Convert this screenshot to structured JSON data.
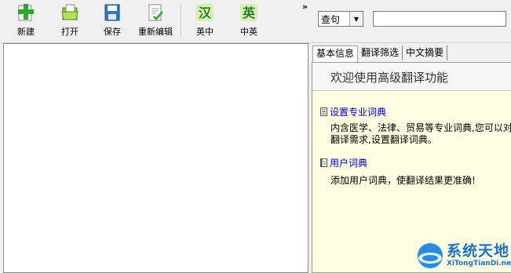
{
  "toolbar": {
    "buttons": [
      {
        "label": "新建",
        "icon": "new-plus-icon"
      },
      {
        "label": "打开",
        "icon": "open-folder-icon"
      },
      {
        "label": "保存",
        "icon": "save-floppy-icon"
      },
      {
        "label": "重新编辑",
        "icon": "edit-document-icon"
      },
      {
        "label": "英中",
        "icon": "english-to-chinese-icon"
      },
      {
        "label": "中英",
        "icon": "chinese-to-english-icon"
      }
    ],
    "overflow": "»"
  },
  "search": {
    "mode_selected": "查句",
    "value": ""
  },
  "right_panel": {
    "tabs": [
      "基本信息",
      "翻译筛选",
      "中文摘要"
    ],
    "active_tab": 0,
    "welcome": "欢迎使用高级翻译功能",
    "items": [
      {
        "title": "设置专业词典",
        "desc_line1": "内含医学、法律、贸易等专业词典,您可以对",
        "desc_line2": "翻译需求,设置翻译词典。"
      },
      {
        "title": "用户词典",
        "desc_line1": "添加用户词典，使翻译结果更准确!"
      }
    ]
  },
  "watermark": {
    "title": "系统天地",
    "subtitle": "XiTongTianDi.net"
  },
  "colors": {
    "link": "#0000cc",
    "panel_bg": "#fffde1",
    "brand": "#1a73c7"
  }
}
